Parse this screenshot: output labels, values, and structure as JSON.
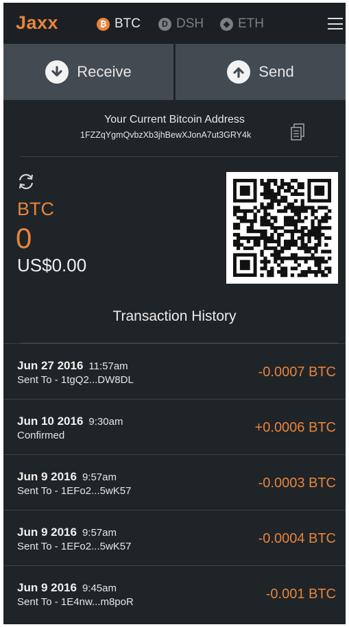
{
  "header": {
    "logo": "Jaxx",
    "tabs": [
      {
        "symbol": "BTC",
        "icon": "bitcoin-icon",
        "active": true
      },
      {
        "symbol": "DSH",
        "icon": "dash-icon",
        "active": false
      },
      {
        "symbol": "ETH",
        "icon": "ethereum-icon",
        "active": false
      }
    ],
    "menu_icon": "hamburger-menu-icon"
  },
  "actions": {
    "receive_label": "Receive",
    "receive_icon": "arrow-down-circle-icon",
    "send_label": "Send",
    "send_icon": "arrow-up-circle-icon"
  },
  "address": {
    "title": "Your Current Bitcoin Address",
    "value": "1FZZqYgmQvbzXb3jhBewXJonA7ut3GRY4k",
    "copy_icon": "copy-icon"
  },
  "balance": {
    "refresh_icon": "refresh-icon",
    "coin": "BTC",
    "amount": "0",
    "fiat": "US$0.00",
    "qr_icon": "qr-code"
  },
  "history": {
    "title": "Transaction History",
    "transactions": [
      {
        "date": "Jun 27 2016",
        "time": "11:57am",
        "detail": "Sent To - 1tgQ2...DW8DL",
        "amount": "-0.0007 BTC"
      },
      {
        "date": "Jun 10 2016",
        "time": "9:30am",
        "detail": "Confirmed",
        "amount": "+0.0006 BTC"
      },
      {
        "date": "Jun 9 2016",
        "time": "9:57am",
        "detail": "Sent To - 1EFo2...5wK57",
        "amount": "-0.0003 BTC"
      },
      {
        "date": "Jun 9 2016",
        "time": "9:57am",
        "detail": "Sent To - 1EFo2...5wK57",
        "amount": "-0.0004 BTC"
      },
      {
        "date": "Jun 9 2016",
        "time": "9:45am",
        "detail": "Sent To - 1E4nw...m8poR",
        "amount": "-0.001 BTC"
      }
    ]
  },
  "colors": {
    "accent": "#e8843c",
    "background": "#1f2428",
    "button": "#434b52"
  }
}
